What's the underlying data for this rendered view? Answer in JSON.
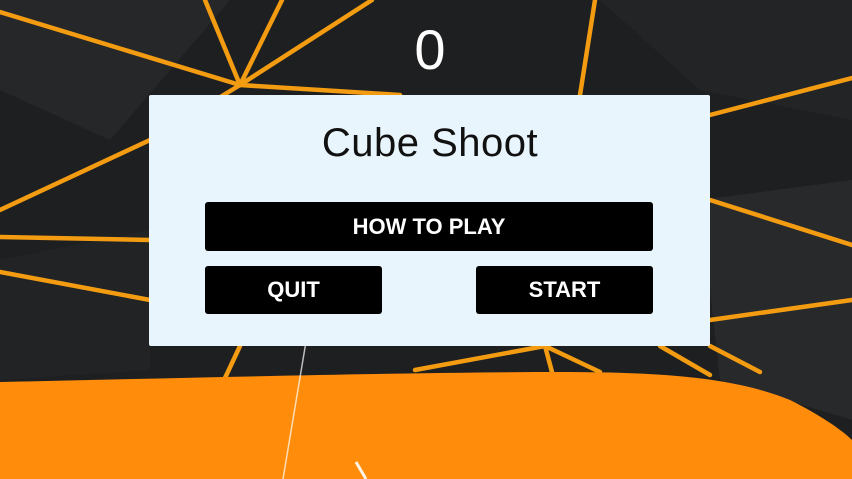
{
  "game": {
    "score": "0",
    "title": "Cube Shoot",
    "buttons": {
      "how_to_play": "HOW TO PLAY",
      "quit": "QUIT",
      "start": "START"
    }
  },
  "colors": {
    "background": "#1e1f21",
    "lines": "#f39c12",
    "floor": "#ff8c0a",
    "panel": "#e9f5fc",
    "button": "#000000"
  }
}
